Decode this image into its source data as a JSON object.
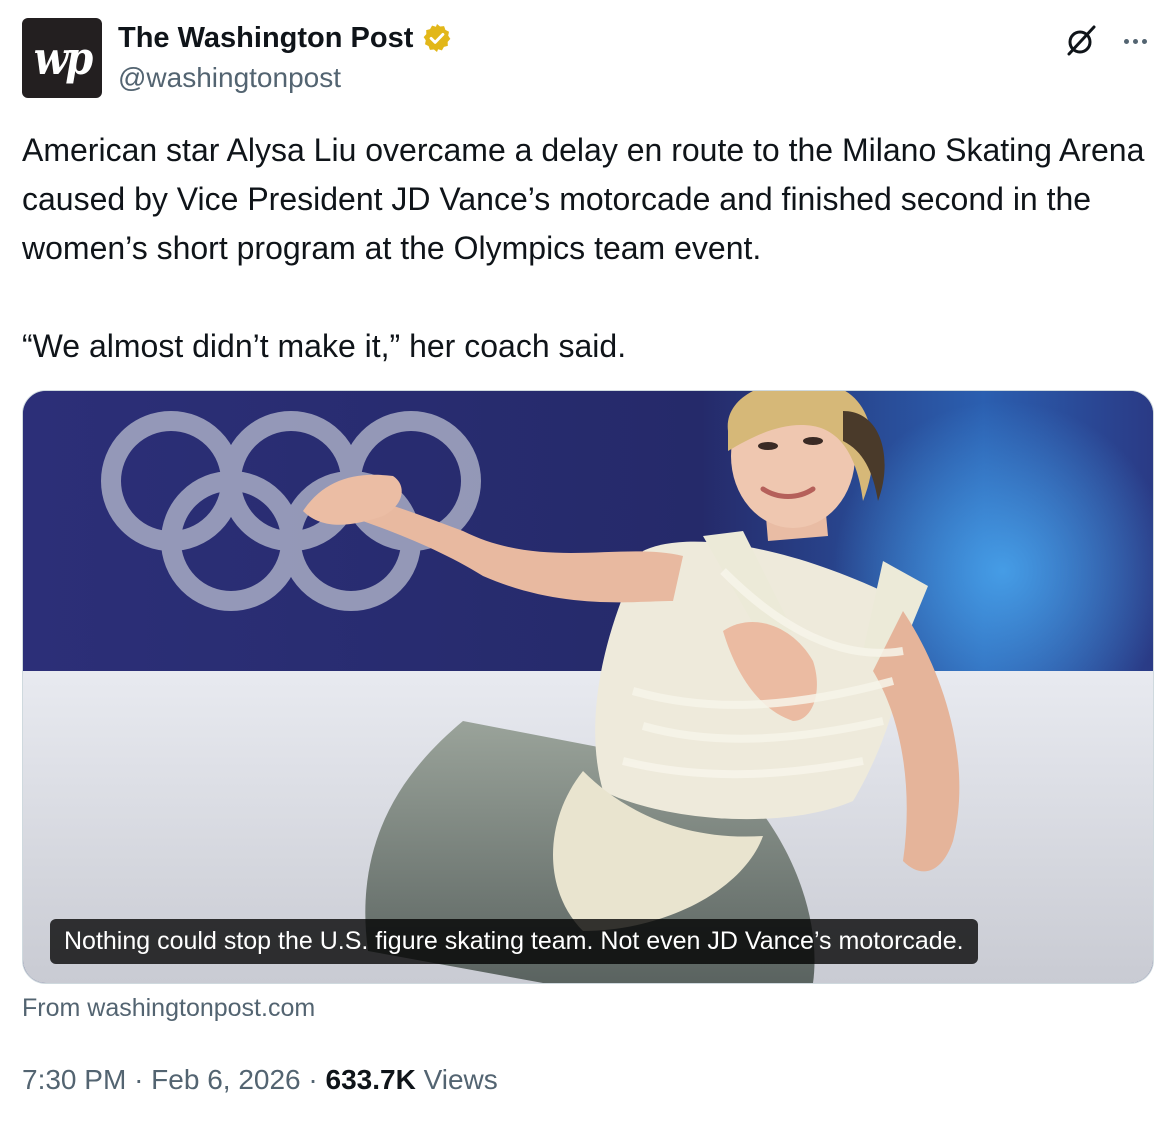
{
  "author": {
    "avatar_text": "wp",
    "display_name": "The Washington Post",
    "handle": "@washingtonpost",
    "verified_badge_color": "#e2b719"
  },
  "tweet": {
    "paragraphs": [
      "American star Alysa Liu overcame a delay en route to the Milano Skating Arena caused by Vice President JD Vance’s motorcade and finished second in the women’s short program at the Olympics team event.",
      "“We almost didn’t make it,” her coach said."
    ]
  },
  "media": {
    "caption": "Nothing could stop the U.S. figure skating team. Not even JD Vance’s motorcade.",
    "source": "From washingtonpost.com"
  },
  "meta": {
    "time": "7:30 PM",
    "separator": "·",
    "date": "Feb 6, 2026",
    "views_count": "633.7K",
    "views_label": "Views"
  },
  "icons": {
    "grok": "grok-icon",
    "more": "more-icon",
    "verified": "verified-badge-icon"
  },
  "colors": {
    "text_primary": "#0f1419",
    "text_secondary": "#536471",
    "card_border": "#cfd9de",
    "avatar_bg": "#231f20"
  }
}
